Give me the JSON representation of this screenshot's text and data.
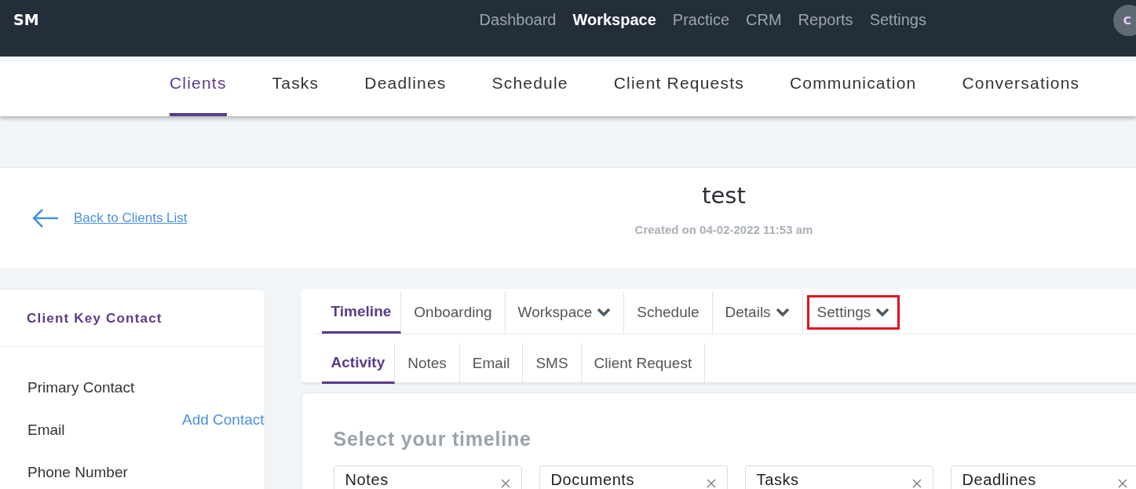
{
  "brand": "SM",
  "top_nav": [
    {
      "label": "Dashboard",
      "selected": false
    },
    {
      "label": "Workspace",
      "selected": true
    },
    {
      "label": "Practice",
      "selected": false
    },
    {
      "label": "CRM",
      "selected": false
    },
    {
      "label": "Reports",
      "selected": false
    },
    {
      "label": "Settings",
      "selected": false
    }
  ],
  "avatar": {
    "initial": "C"
  },
  "sub_nav": [
    {
      "label": "Clients",
      "selected": true
    },
    {
      "label": "Tasks",
      "selected": false
    },
    {
      "label": "Deadlines",
      "selected": false
    },
    {
      "label": "Schedule",
      "selected": false
    },
    {
      "label": "Client Requests",
      "selected": false
    },
    {
      "label": "Communication",
      "selected": false
    },
    {
      "label": "Conversations",
      "selected": false
    }
  ],
  "header": {
    "back_link": "Back to Clients List",
    "title": "test",
    "created": "Created on 04-02-2022 11:53 am"
  },
  "contact_card": {
    "title": "Client Key Contact",
    "fields": [
      "Primary Contact",
      "Email",
      "Phone Number"
    ],
    "action": "Add Contact"
  },
  "client_tabs": [
    {
      "label": "Timeline",
      "selected": true,
      "dropdown": false,
      "highlighted": false
    },
    {
      "label": "Onboarding",
      "selected": false,
      "dropdown": false,
      "highlighted": false
    },
    {
      "label": "Workspace",
      "selected": false,
      "dropdown": true,
      "highlighted": false
    },
    {
      "label": "Schedule",
      "selected": false,
      "dropdown": false,
      "highlighted": false
    },
    {
      "label": "Details",
      "selected": false,
      "dropdown": true,
      "highlighted": false
    },
    {
      "label": "Settings",
      "selected": false,
      "dropdown": true,
      "highlighted": true
    }
  ],
  "timeline_tabs": [
    {
      "label": "Activity",
      "selected": true
    },
    {
      "label": "Notes",
      "selected": false
    },
    {
      "label": "Email",
      "selected": false
    },
    {
      "label": "SMS",
      "selected": false
    },
    {
      "label": "Client Request",
      "selected": false
    }
  ],
  "timeline_select": {
    "title": "Select your timeline",
    "chips": [
      "Notes",
      "Documents",
      "Tasks",
      "Deadlines"
    ]
  }
}
